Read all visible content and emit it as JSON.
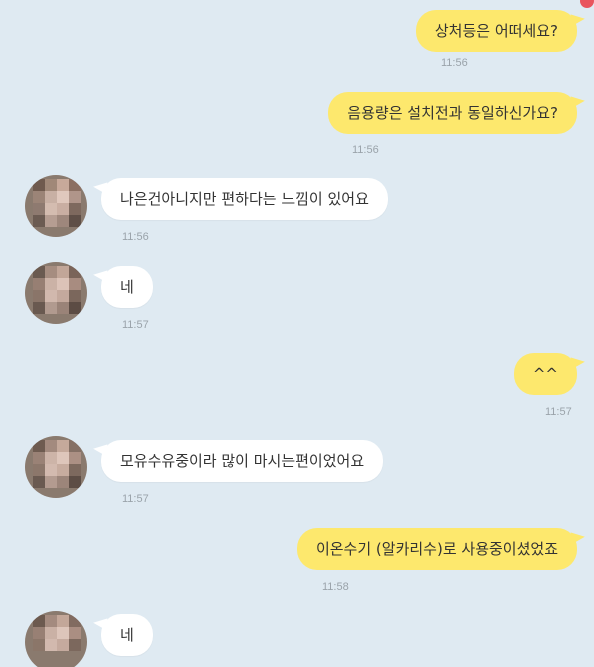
{
  "messages": [
    {
      "sender": "me",
      "text": "상처등은 어떠세요?",
      "time": "11:56"
    },
    {
      "sender": "me",
      "text": "음용량은 설치전과 동일하신가요?",
      "time": "11:56"
    },
    {
      "sender": "them",
      "text": "나은건아니지만 편하다는 느낌이 있어요",
      "time": "11:56"
    },
    {
      "sender": "them",
      "text": "네",
      "time": "11:57"
    },
    {
      "sender": "me",
      "text": "^^",
      "time": "11:57"
    },
    {
      "sender": "them",
      "text": "모유수유중이라 많이 마시는편이었어요",
      "time": "11:57"
    },
    {
      "sender": "me",
      "text": "이온수기 (알카리수)로 사용중이셨었죠",
      "time": "11:58"
    },
    {
      "sender": "them",
      "text": "네",
      "time": ""
    }
  ],
  "colors": {
    "background": "#dfeaf2",
    "my_bubble": "#fde86d",
    "their_bubble": "#ffffff",
    "timestamp": "#9aa3aa",
    "badge": "#e9545d"
  },
  "icons": {
    "avatar": "pixelated-profile-avatar",
    "badge": "notification-badge"
  }
}
